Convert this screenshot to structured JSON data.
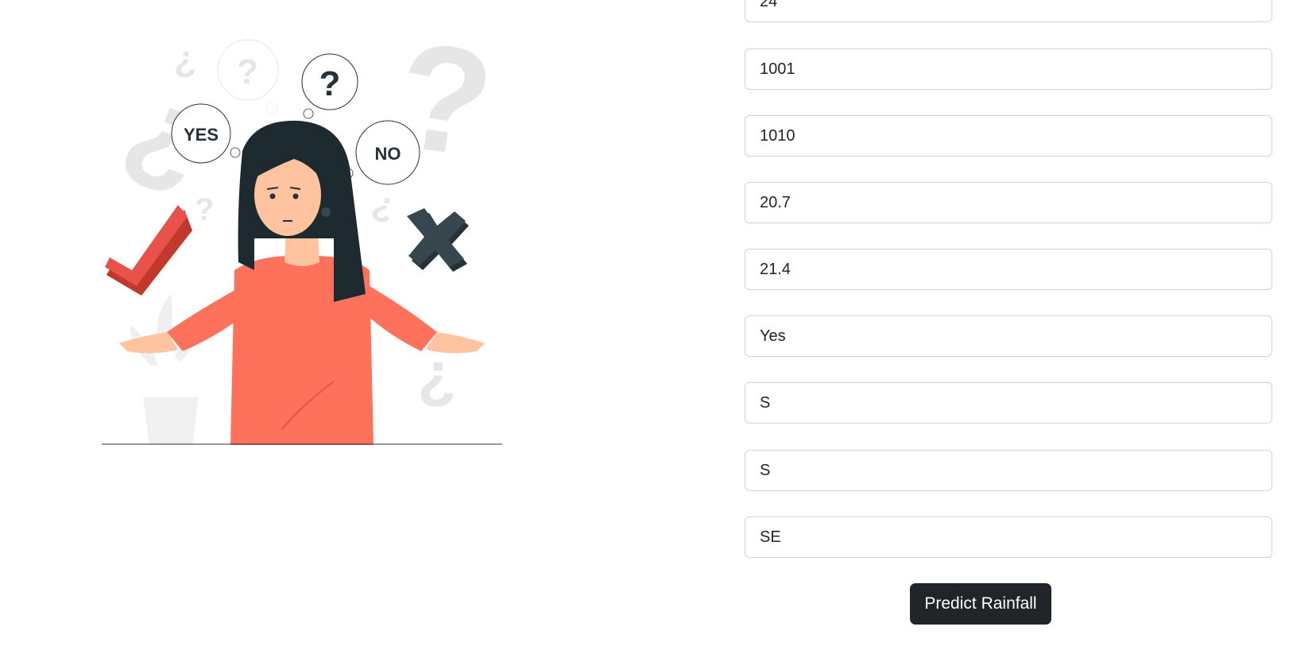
{
  "illustration": {
    "bubble_yes": "YES",
    "bubble_no": "NO",
    "bubble_question": "?"
  },
  "form": {
    "fields": [
      {
        "value": "24"
      },
      {
        "value": "1001"
      },
      {
        "value": "1010"
      },
      {
        "value": "20.7"
      },
      {
        "value": "21.4"
      },
      {
        "value": "Yes"
      },
      {
        "value": "S"
      },
      {
        "value": "S"
      },
      {
        "value": "SE"
      }
    ],
    "submit_label": "Predict Rainfall"
  },
  "colors": {
    "button_bg": "#212529",
    "field_border": "#ced4da",
    "shirt": "#fe725c",
    "hair": "#1d2b30",
    "check": "#e8524a",
    "cross": "#37474f"
  }
}
